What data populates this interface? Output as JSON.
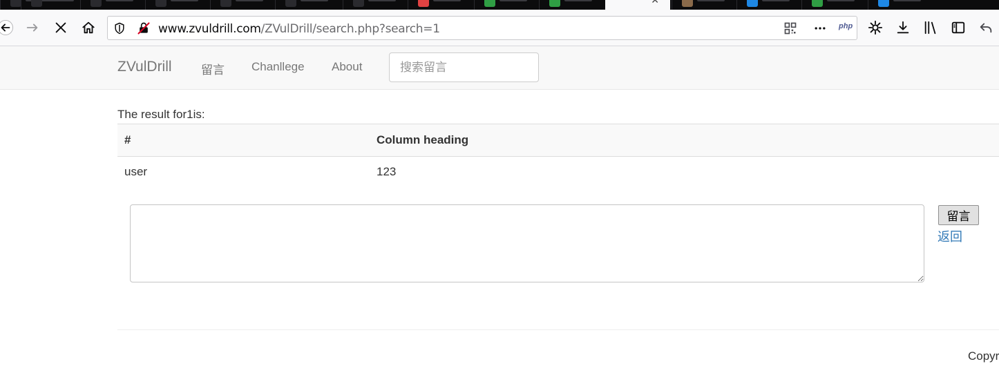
{
  "browser": {
    "tabs": [
      {
        "favicon_color": "#2a2a2e"
      },
      {
        "favicon_color": "#2a2a2e"
      },
      {
        "favicon_color": "#2a2a2e"
      },
      {
        "favicon_color": "#2a2a2e"
      },
      {
        "favicon_color": "#2a2a2e"
      },
      {
        "favicon_color": "#2a2a2e"
      },
      {
        "favicon_color": "#2a2a2e"
      },
      {
        "favicon_color": "#e04242"
      },
      {
        "favicon_color": "#2f9e44"
      },
      {
        "favicon_color": "#2f9e44"
      },
      {
        "favicon_color": "#f9f9fa",
        "active": true
      },
      {
        "favicon_color": "#8a6a4a"
      },
      {
        "favicon_color": "#1e88e5"
      },
      {
        "favicon_color": "#2f9e44"
      },
      {
        "favicon_color": "#1e88e5"
      }
    ],
    "url_domain": "www.zvuldrill.com",
    "url_path": "/ZVulDrill/search.php?search=1",
    "php_badge": "php",
    "accent": "#0060df"
  },
  "site": {
    "brand": "ZVulDrill",
    "nav": [
      "留言",
      "Chanllege",
      "About"
    ],
    "search_placeholder": "搜索留言"
  },
  "results": {
    "caption": "The result for1is:",
    "headers": [
      "#",
      "Column heading"
    ],
    "rows": [
      [
        "user",
        "123"
      ]
    ]
  },
  "comment": {
    "value": "",
    "submit_label": "留言",
    "back_label": "返回"
  },
  "footer": {
    "copyright": "Copyr"
  },
  "colors": {
    "link": "#337ab7",
    "navbar_bg": "#f8f8f8",
    "text": "#333333"
  }
}
